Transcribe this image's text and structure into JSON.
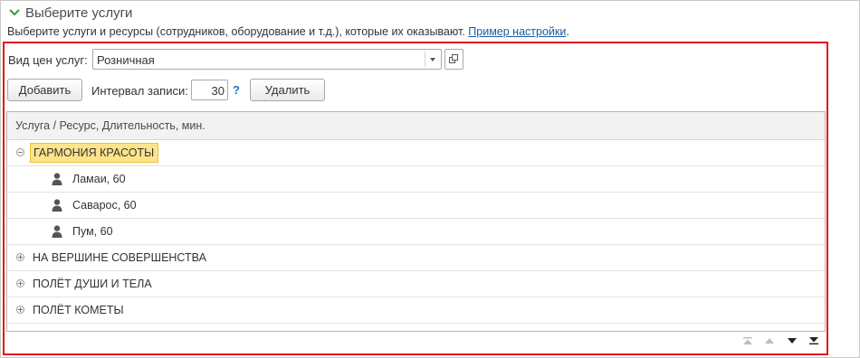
{
  "section": {
    "title": "Выберите услуги",
    "subtitle_text": "Выберите услуги и ресурсы (сотрудников, оборудование и т.д.), которые их оказывают.",
    "subtitle_link": "Пример настройки",
    "subtitle_end": "."
  },
  "price_type": {
    "label": "Вид цен услуг:",
    "value": "Розничная"
  },
  "toolbar": {
    "add_label": "Добавить",
    "interval_label": "Интервал записи:",
    "interval_value": "30",
    "help_label": "?",
    "delete_label": "Удалить"
  },
  "table": {
    "header": "Услуга / Ресурс, Длительность, мин.",
    "rows": [
      {
        "type": "group",
        "label": "ГАРМОНИЯ КРАСОТЫ",
        "expanded": true,
        "selected": true
      },
      {
        "type": "resource",
        "label": "Ламаи, 60"
      },
      {
        "type": "resource",
        "label": "Саварос, 60"
      },
      {
        "type": "resource",
        "label": "Пум, 60"
      },
      {
        "type": "group",
        "label": "НА ВЕРШИНЕ СОВЕРШЕНСТВА",
        "expanded": false
      },
      {
        "type": "group",
        "label": "ПОЛЁТ ДУШИ И ТЕЛА",
        "expanded": false
      },
      {
        "type": "group",
        "label": "ПОЛЁТ КОМЕТЫ",
        "expanded": false
      }
    ]
  },
  "icons": {
    "section": "chevron-down-icon",
    "resource": "person-icon",
    "open": "open-form-icon",
    "dropdown": "dropdown-arrow-icon"
  },
  "colors": {
    "accent_green": "#2e9e3e",
    "link_blue": "#1c5b9e",
    "highlight_red": "#e01010",
    "selection_yellow": "#fde48a"
  }
}
